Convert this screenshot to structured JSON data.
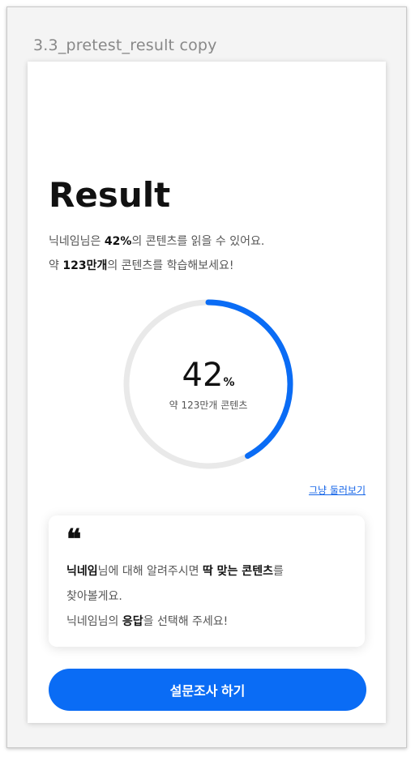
{
  "artboard": {
    "title": "3.3_pretest_result copy"
  },
  "result": {
    "title": "Result",
    "line1_prefix": "닉네임님은 ",
    "line1_percent": "42%",
    "line1_suffix": "의 콘텐츠를 읽을 수 있어요.",
    "line2_prefix": "약 ",
    "line2_count": "123만개",
    "line2_suffix": "의 콘텐츠를 학습해보세요!"
  },
  "gauge": {
    "value": "42",
    "unit": "%",
    "progress": 0.42,
    "caption": "약 123만개 콘텐츠",
    "track_color": "#e9e9e9",
    "fill_color": "#0a6cf5"
  },
  "links": {
    "browse": "그냥 둘러보기"
  },
  "quote": {
    "mark": "❝",
    "p1_bold": "닉네임",
    "p1_mid": "님에 대해 알려주시면 ",
    "p1_bold2": "딱 맞는 콘텐츠",
    "p1_end": "를",
    "p2": "찾아볼게요.",
    "p3_prefix": "닉네임님의 ",
    "p3_bold": "응답",
    "p3_suffix": "을 선택해 주세요!"
  },
  "cta": {
    "label": "설문조사 하기",
    "color": "#0a6cf5"
  }
}
